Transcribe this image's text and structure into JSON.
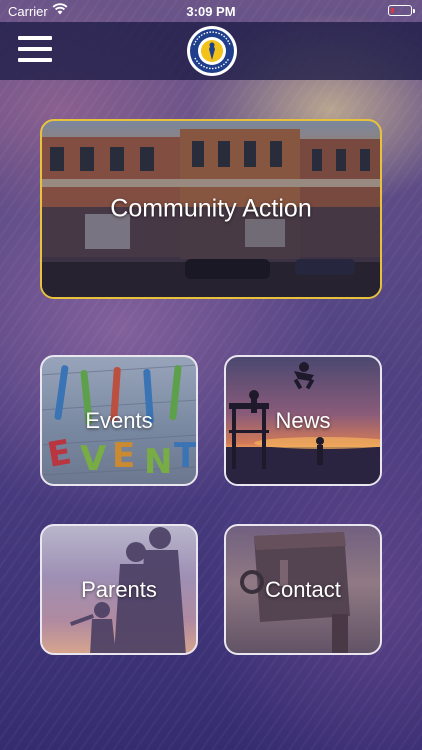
{
  "status_bar": {
    "carrier": "Carrier",
    "time": "3:09 PM",
    "battery_level": 0.2
  },
  "header": {
    "menu_icon": "hamburger-menu-icon",
    "logo_icon": "drug-alcohol-task-force-logo"
  },
  "tiles": {
    "community_action": "Community Action",
    "events": "Events",
    "news": "News",
    "parents": "Parents",
    "contact": "Contact"
  },
  "colors": {
    "accent_border": "#e8c23a",
    "tile_border": "#e9e6f0",
    "header_bg": "#1e1c46",
    "battery_low": "#e5333f"
  }
}
